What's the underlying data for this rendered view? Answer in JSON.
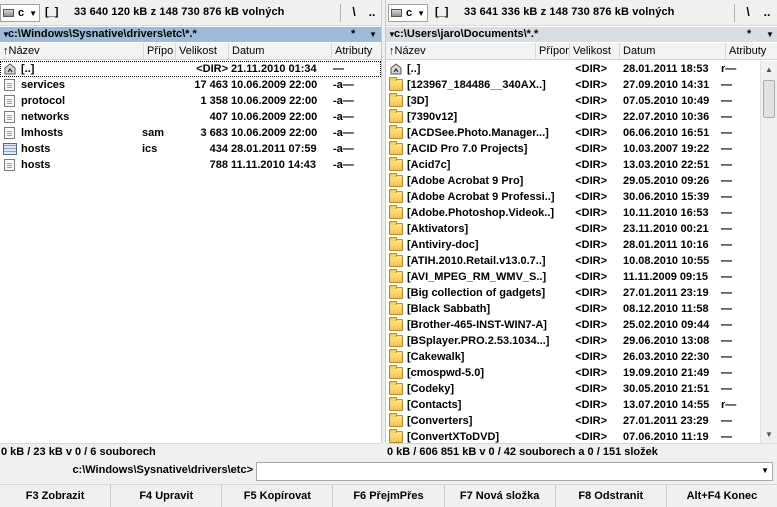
{
  "left": {
    "drive_letter": "c",
    "drive_label": "[_]",
    "free_info": "33 640 120 kB z 148 730 876 kB volných",
    "root_btn": "\\",
    "up_btn": "..",
    "path": "c:\\Windows\\Sysnative\\drivers\\etc\\*.*",
    "filter_star": "*",
    "columns": [
      "Název",
      "Přípo",
      "Velikost",
      "Datum",
      "Atributy"
    ],
    "files": [
      {
        "name": "[..]",
        "ext": "",
        "size": "<DIR>",
        "date": "21.11.2010 01:34",
        "attr": "—",
        "icon": "up-arrow-icon"
      },
      {
        "name": "services",
        "ext": "",
        "size": "17 463",
        "date": "10.06.2009 22:00",
        "attr": "-a—",
        "icon": "file-icon"
      },
      {
        "name": "protocol",
        "ext": "",
        "size": "1 358",
        "date": "10.06.2009 22:00",
        "attr": "-a—",
        "icon": "file-icon"
      },
      {
        "name": "networks",
        "ext": "",
        "size": "407",
        "date": "10.06.2009 22:00",
        "attr": "-a—",
        "icon": "file-icon"
      },
      {
        "name": "lmhosts",
        "ext": "sam",
        "size": "3 683",
        "date": "10.06.2009 22:00",
        "attr": "-a—",
        "icon": "file-icon"
      },
      {
        "name": "hosts",
        "ext": "ics",
        "size": "434",
        "date": "28.01.2011 07:59",
        "attr": "-a—",
        "icon": "calendar-file-icon"
      },
      {
        "name": "hosts",
        "ext": "",
        "size": "788",
        "date": "11.11.2010 14:43",
        "attr": "-a—",
        "icon": "file-icon"
      }
    ],
    "status": "0 kB / 23 kB v 0 / 6 souborech"
  },
  "right": {
    "drive_letter": "c",
    "drive_label": "[_]",
    "free_info": "33 641 336 kB z 148 730 876 kB volných",
    "root_btn": "\\",
    "up_btn": "..",
    "path": "c:\\Users\\jaro\\Documents\\*.*",
    "filter_star": "*",
    "columns": [
      "Název",
      "Přípona",
      "Velikost",
      "Datum",
      "Atributy"
    ],
    "files": [
      {
        "name": "[..]",
        "size": "<DIR>",
        "date": "28.01.2011 18:53",
        "attr": "r—",
        "icon": "up-arrow-icon"
      },
      {
        "name": "[123967_184486__340AX..]",
        "size": "<DIR>",
        "date": "27.09.2010 14:31",
        "attr": "—",
        "icon": "folder-icon"
      },
      {
        "name": "[3D]",
        "size": "<DIR>",
        "date": "07.05.2010 10:49",
        "attr": "—",
        "icon": "folder-icon"
      },
      {
        "name": "[7390v12]",
        "size": "<DIR>",
        "date": "22.07.2010 10:36",
        "attr": "—",
        "icon": "folder-icon"
      },
      {
        "name": "[ACDSee.Photo.Manager...]",
        "size": "<DIR>",
        "date": "06.06.2010 16:51",
        "attr": "—",
        "icon": "folder-icon"
      },
      {
        "name": "[ACID Pro 7.0 Projects]",
        "size": "<DIR>",
        "date": "10.03.2007 19:22",
        "attr": "—",
        "icon": "folder-icon"
      },
      {
        "name": "[Acid7c]",
        "size": "<DIR>",
        "date": "13.03.2010 22:51",
        "attr": "—",
        "icon": "folder-icon"
      },
      {
        "name": "[Adobe Acrobat 9 Pro]",
        "size": "<DIR>",
        "date": "29.05.2010 09:26",
        "attr": "—",
        "icon": "folder-icon"
      },
      {
        "name": "[Adobe Acrobat 9 Professi..]",
        "size": "<DIR>",
        "date": "30.06.2010 15:39",
        "attr": "—",
        "icon": "folder-icon"
      },
      {
        "name": "[Adobe.Photoshop.Videok..]",
        "size": "<DIR>",
        "date": "10.11.2010 16:53",
        "attr": "—",
        "icon": "folder-icon"
      },
      {
        "name": "[Aktivators]",
        "size": "<DIR>",
        "date": "23.11.2010 00:21",
        "attr": "—",
        "icon": "folder-icon"
      },
      {
        "name": "[Antiviry-doc]",
        "size": "<DIR>",
        "date": "28.01.2011 10:16",
        "attr": "—",
        "icon": "folder-icon"
      },
      {
        "name": "[ATIH.2010.Retail.v13.0.7..]",
        "size": "<DIR>",
        "date": "10.08.2010 10:55",
        "attr": "—",
        "icon": "folder-icon"
      },
      {
        "name": "[AVI_MPEG_RM_WMV_S..]",
        "size": "<DIR>",
        "date": "11.11.2009 09:15",
        "attr": "—",
        "icon": "folder-icon"
      },
      {
        "name": "[Big collection of gadgets]",
        "size": "<DIR>",
        "date": "27.01.2011 23:19",
        "attr": "—",
        "icon": "folder-icon"
      },
      {
        "name": "[Black Sabbath]",
        "size": "<DIR>",
        "date": "08.12.2010 11:58",
        "attr": "—",
        "icon": "folder-icon"
      },
      {
        "name": "[Brother-465-INST-WIN7-A]",
        "size": "<DIR>",
        "date": "25.02.2010 09:44",
        "attr": "—",
        "icon": "folder-icon"
      },
      {
        "name": "[BSplayer.PRO.2.53.1034...]",
        "size": "<DIR>",
        "date": "29.06.2010 13:08",
        "attr": "—",
        "icon": "folder-icon"
      },
      {
        "name": "[Cakewalk]",
        "size": "<DIR>",
        "date": "26.03.2010 22:30",
        "attr": "—",
        "icon": "folder-icon"
      },
      {
        "name": "[cmospwd-5.0]",
        "size": "<DIR>",
        "date": "19.09.2010 21:49",
        "attr": "—",
        "icon": "folder-icon"
      },
      {
        "name": "[Codeky]",
        "size": "<DIR>",
        "date": "30.05.2010 21:51",
        "attr": "—",
        "icon": "folder-icon"
      },
      {
        "name": "[Contacts]",
        "size": "<DIR>",
        "date": "13.07.2010 14:55",
        "attr": "r—",
        "icon": "folder-icon"
      },
      {
        "name": "[Converters]",
        "size": "<DIR>",
        "date": "27.01.2011 23:29",
        "attr": "—",
        "icon": "folder-icon"
      },
      {
        "name": "[ConvertXToDVD]",
        "size": "<DIR>",
        "date": "07.06.2010 11:19",
        "attr": "—",
        "icon": "folder-icon"
      }
    ],
    "status": "0 kB / 606 851 kB v 0 / 42 souborech a 0 / 151 složek"
  },
  "command": {
    "path": "c:\\Windows\\Sysnative\\drivers\\etc>",
    "value": ""
  },
  "fkeys": [
    "F3 Zobrazit",
    "F4 Upravit",
    "F5 Kopírovat",
    "F6 PřejmPřes",
    "F7 Nová složka",
    "F8 Odstranit",
    "Alt+F4 Konec"
  ],
  "colors": {
    "active_path_bg": "#9dbbd8",
    "inactive_path_bg": "#d8dde3",
    "folder": "#efc450"
  }
}
